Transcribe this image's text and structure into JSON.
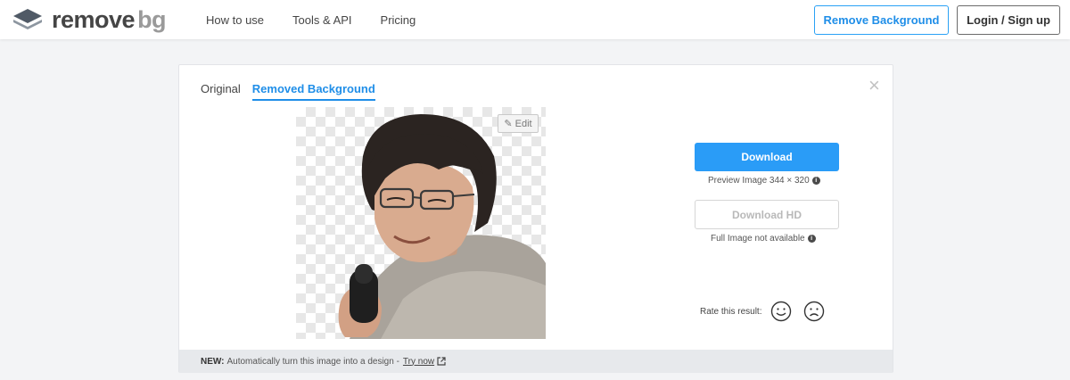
{
  "header": {
    "logo_main": "remove",
    "logo_sub": "bg",
    "nav": [
      "How to use",
      "Tools & API",
      "Pricing"
    ],
    "remove_button": "Remove Background",
    "login_button": "Login / Sign up"
  },
  "card": {
    "tabs": [
      {
        "label": "Original",
        "active": false
      },
      {
        "label": "Removed Background",
        "active": true
      }
    ],
    "close_icon": "×",
    "edit_label": "Edit",
    "download_label": "Download",
    "preview_caption": "Preview Image 344 × 320",
    "download_hd_label": "Download HD",
    "hd_caption": "Full Image not available",
    "rate_label": "Rate this result:",
    "footer": {
      "new_label": "NEW:",
      "text": "Automatically turn this image into a design -",
      "link": "Try now"
    }
  },
  "colors": {
    "accent": "#2a9cf7",
    "accent_text": "#1f8ee8",
    "page_bg": "#f3f4f6"
  },
  "icons": [
    "layers-logo-icon",
    "close-icon",
    "pencil-icon",
    "info-icon",
    "smile-icon",
    "frown-icon",
    "external-link-icon"
  ]
}
